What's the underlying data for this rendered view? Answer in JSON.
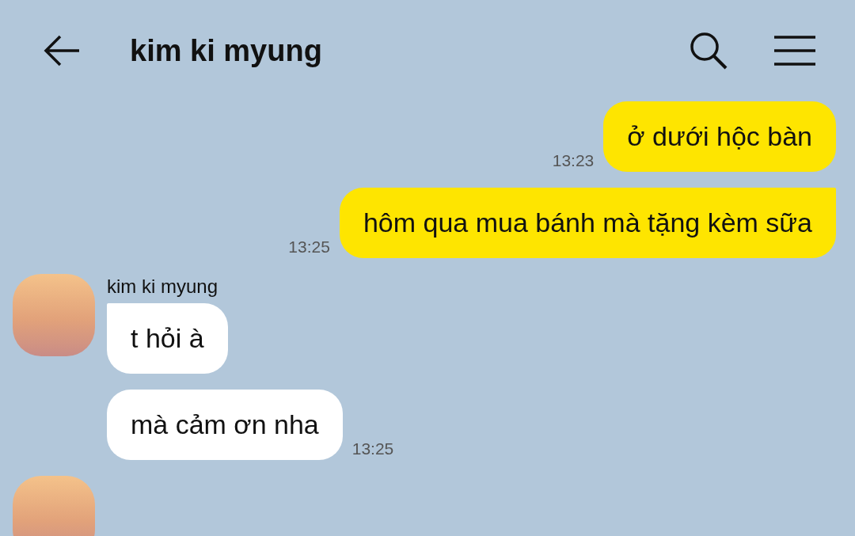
{
  "header": {
    "title": "kim ki myung"
  },
  "groups": [
    {
      "kind": "sent",
      "messages": [
        {
          "text": "ở dưới hộc bàn",
          "time": "13:23",
          "tail": false
        },
        {
          "text": "hôm qua mua bánh mà tặng kèm sữa",
          "time": "13:25",
          "tail": true
        }
      ]
    },
    {
      "kind": "received",
      "sender": "kim ki myung",
      "messages": [
        {
          "text": "t hỏi à",
          "tail": true
        },
        {
          "text": "mà cảm ơn nha",
          "time": "13:25",
          "tail": false
        }
      ]
    },
    {
      "kind": "received"
    }
  ]
}
